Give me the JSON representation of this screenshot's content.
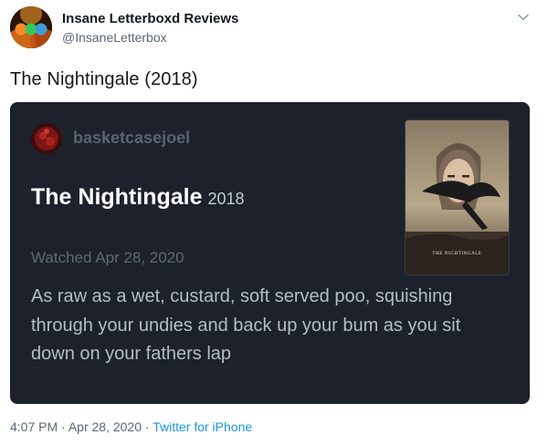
{
  "tweet": {
    "author": {
      "name": "Insane Letterboxd Reviews",
      "handle": "@InsaneLetterbox"
    },
    "text": "The Nightingale (2018)",
    "timestamp": "4:07 PM",
    "separator": "·",
    "date": "Apr 28, 2020",
    "source": "Twitter for iPhone"
  },
  "card": {
    "username": "basketcasejoel",
    "film_title": "The Nightingale",
    "film_year": "2018",
    "watched": "Watched Apr 28, 2020",
    "review": "As raw as a wet, custard, soft served poo, squishing through your undies and back up your bum as you sit down on your fathers lap",
    "poster_caption": "THE NIGHTINGALE"
  },
  "icons": {
    "menu": "chevron-down-icon",
    "avatar": "profile-avatar",
    "card_avatar": "reviewer-avatar"
  },
  "colors": {
    "card_bg": "#1c212b",
    "link": "#1b95e0",
    "muted": "#5b6772"
  }
}
